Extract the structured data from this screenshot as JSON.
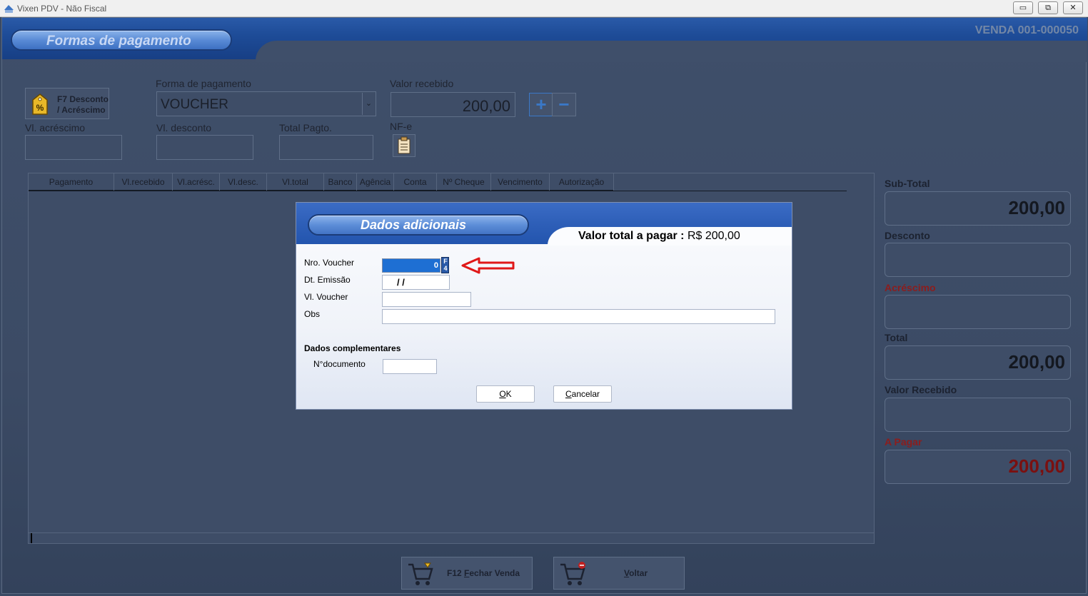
{
  "window": {
    "title": "Vixen PDV - Não Fiscal",
    "minimize": "▭",
    "restore": "⧉",
    "close": "✕"
  },
  "header": {
    "section_title": "Formas de pagamento",
    "venda": "VENDA 001-000050"
  },
  "form": {
    "discount_button_line1": "F7 Desconto",
    "discount_button_line2": "/ Acréscimo",
    "forma_label": "Forma de pagamento",
    "forma_value": "VOUCHER",
    "valor_recebido_label": "Valor recebido",
    "valor_recebido_value": "200,00",
    "plus": "+",
    "minus": "−",
    "acrescimo_label": "Vl. acréscimo",
    "desconto_label": "Vl. desconto",
    "total_pagto_label": "Total Pagto.",
    "nfe_label": "NF-e"
  },
  "table": {
    "columns": [
      "Pagamento",
      "Vl.recebido",
      "Vl.acrésc.",
      "Vl.desc.",
      "Vl.total",
      "Banco",
      "Agência",
      "Conta",
      "Nº Cheque",
      "Vencimento",
      "Autorização"
    ]
  },
  "totals": {
    "subtotal_label": "Sub-Total",
    "subtotal_value": "200,00",
    "desconto_label": "Desconto",
    "desconto_value": "",
    "acrescimo_label": "Acréscimo",
    "acrescimo_value": "",
    "total_label": "Total",
    "total_value": "200,00",
    "valor_recebido_label": "Valor Recebido",
    "valor_recebido_value": "",
    "a_pagar_label": "A Pagar",
    "a_pagar_value": "200,00"
  },
  "bottom": {
    "fechar_prefix": "F12 ",
    "fechar_underline": "F",
    "fechar_rest": "echar Venda",
    "voltar_underline": "V",
    "voltar_rest": "oltar"
  },
  "dialog": {
    "title": "Dados adicionais",
    "total_label": "Valor total a pagar :",
    "total_value": "R$ 200,00",
    "nro_voucher_label": "Nro. Voucher",
    "nro_voucher_value": "0",
    "f4_label": "F4",
    "dt_emissao_label": "Dt. Emissão",
    "dt_emissao_value": "/    /",
    "vl_voucher_label": "Vl. Voucher",
    "obs_label": "Obs",
    "complementares_label": "Dados complementares",
    "ndocumento_label": "N°documento",
    "ok_underline": "O",
    "ok_rest": "K",
    "cancel_underline": "C",
    "cancel_rest": "ancelar"
  },
  "colors": {
    "accent_blue": "#2a5aa8",
    "alert_red": "#8c1d1d",
    "arrow_red": "#e01818"
  }
}
